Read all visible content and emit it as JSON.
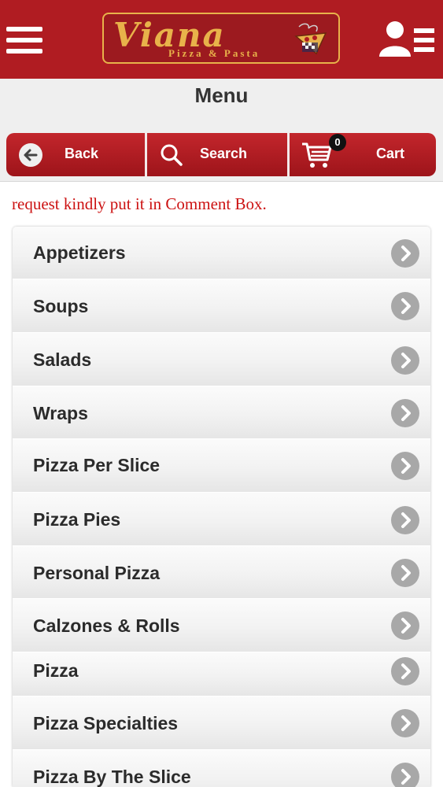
{
  "header": {
    "brand_script": "Viana",
    "brand_sub": "Pizza & Pasta",
    "accent_color": "#b01c22",
    "logo_color": "#e8b24a",
    "icons": [
      "hamburger-menu-icon",
      "pizza-chef-icon",
      "user-list-icon"
    ]
  },
  "page": {
    "title": "Menu"
  },
  "actions": {
    "back_label": "Back",
    "search_label": "Search",
    "cart_label": "Cart",
    "cart_count": "0",
    "icons": [
      "back-arrow-icon",
      "search-icon",
      "cart-icon"
    ]
  },
  "notice": {
    "text": "request kindly put it in Comment Box.",
    "color": "#cc1111"
  },
  "menu": {
    "items": [
      {
        "label": "Appetizers"
      },
      {
        "label": "Soups"
      },
      {
        "label": "Salads"
      },
      {
        "label": "Wraps"
      },
      {
        "label": "Pizza Per Slice"
      },
      {
        "label": "Pizza Pies"
      },
      {
        "label": "Personal Pizza"
      },
      {
        "label": "Calzones & Rolls"
      },
      {
        "label": "Pizza"
      },
      {
        "label": "Pizza Specialties"
      },
      {
        "label": "Pizza By The Slice"
      }
    ],
    "chevron_icon": "chevron-right-icon"
  }
}
